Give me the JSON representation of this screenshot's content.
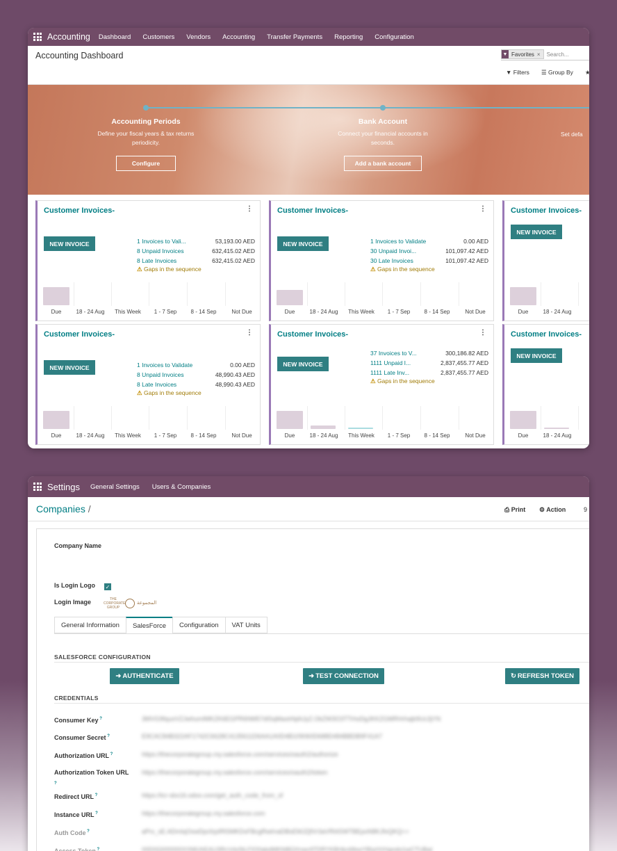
{
  "accounting": {
    "app_name": "Accounting",
    "menu": [
      "Dashboard",
      "Customers",
      "Vendors",
      "Accounting",
      "Transfer Payments",
      "Reporting",
      "Configuration"
    ],
    "page_title": "Accounting Dashboard",
    "search": {
      "facet": "Favorites",
      "placeholder": "Search..."
    },
    "filters_label": "Filters",
    "groupby_label": "Group By",
    "onboarding": {
      "steps": [
        {
          "title": "Accounting Periods",
          "desc": "Define your fiscal years & tax returns periodicity.",
          "button": "Configure"
        },
        {
          "title": "Bank Account",
          "desc": "Connect your financial accounts in seconds.",
          "button": "Add a bank account"
        },
        {
          "title": "",
          "desc": "Set defa",
          "button": ""
        }
      ]
    },
    "cards": [
      {
        "title": "Customer Invoices-",
        "button": "NEW INVOICE",
        "stats": [
          {
            "label": "1 Invoices to Vali...",
            "value": "53,193.00 AED"
          },
          {
            "label": "8 Unpaid Invoices",
            "value": "632,415.02 AED"
          },
          {
            "label": "8 Late Invoices",
            "value": "632,415.02 AED"
          }
        ],
        "warning": "Gaps in the sequence",
        "chart": {
          "type": "bar",
          "categories": [
            "Due",
            "18 - 24 Aug",
            "This Week",
            "1 - 7 Sep",
            "8 - 14 Sep",
            "Not Due"
          ],
          "values": [
            1,
            0,
            0,
            0,
            0,
            0
          ]
        }
      },
      {
        "title": "Customer Invoices-",
        "button": "NEW INVOICE",
        "stats": [
          {
            "label": "1 Invoices to Validate",
            "value": "0.00 AED"
          },
          {
            "label": "30 Unpaid Invoi...",
            "value": "101,097.42 AED"
          },
          {
            "label": "30 Late Invoices",
            "value": "101,097.42 AED"
          }
        ],
        "warning": "Gaps in the sequence",
        "chart": {
          "type": "bar",
          "categories": [
            "Due",
            "18 - 24 Aug",
            "This Week",
            "1 - 7 Sep",
            "8 - 14 Sep",
            "Not Due"
          ],
          "values": [
            0.85,
            0,
            0,
            0,
            0,
            0
          ]
        }
      },
      {
        "title": "Customer Invoices-",
        "button": "NEW INVOICE",
        "stats": [],
        "warning": "",
        "chart": {
          "type": "bar",
          "categories": [
            "Due",
            "18 - 24 Aug",
            "Th"
          ],
          "values": [
            1,
            0,
            0
          ]
        }
      },
      {
        "title": "Customer Invoices-",
        "button": "NEW INVOICE",
        "stats": [
          {
            "label": "1 Invoices to Validate",
            "value": "0.00 AED"
          },
          {
            "label": "8 Unpaid Invoices",
            "value": "48,990.43 AED"
          },
          {
            "label": "8 Late Invoices",
            "value": "48,990.43 AED"
          }
        ],
        "warning": "Gaps in the sequence",
        "chart": {
          "type": "bar",
          "categories": [
            "Due",
            "18 - 24 Aug",
            "This Week",
            "1 - 7 Sep",
            "8 - 14 Sep",
            "Not Due"
          ],
          "values": [
            1,
            0,
            0,
            0,
            0,
            0
          ]
        }
      },
      {
        "title": "Customer Invoices-",
        "button": "NEW INVOICE",
        "stats": [
          {
            "label": "37 Invoices to V...",
            "value": "300,186.82 AED"
          },
          {
            "label": "1111 Unpaid I...",
            "value": "2,837,455.77 AED"
          },
          {
            "label": "1111 Late Inv...",
            "value": "2,837,455.77 AED"
          }
        ],
        "warning": "Gaps in the sequence",
        "chart": {
          "type": "bar",
          "categories": [
            "Due",
            "18 - 24 Aug",
            "This Week",
            "1 - 7 Sep",
            "8 - 14 Sep",
            "Not Due"
          ],
          "values": [
            1,
            0.18,
            0.05,
            0,
            0,
            0
          ]
        }
      },
      {
        "title": "Customer Invoices-",
        "button": "NEW INVOICE",
        "stats": [],
        "warning": "",
        "chart": {
          "type": "bar",
          "categories": [
            "Due",
            "18 - 24 Aug",
            "Th"
          ],
          "values": [
            1,
            0.03,
            0
          ]
        }
      }
    ]
  },
  "settings": {
    "app_name": "Settings",
    "menu": [
      "General Settings",
      "Users & Companies"
    ],
    "breadcrumb": "Companies",
    "breadcrumb_sep": "/",
    "print_label": "Print",
    "action_label": "Action",
    "pager": "9",
    "company_name_label": "Company Name",
    "is_login_logo_label": "Is Login Logo",
    "is_login_logo_checked": true,
    "login_image_label": "Login Image",
    "logo_text": {
      "left": "THE CORPORATE GROUP",
      "right": "المجموعة"
    },
    "tabs": [
      "General Information",
      "SalesForce",
      "Configuration",
      "VAT Units"
    ],
    "active_tab": "SalesForce",
    "sf_section": "SALESFORCE CONFIGURATION",
    "buttons": {
      "authenticate": "AUTHENTICATE",
      "test": "TEST CONNECTION",
      "refresh": "REFRESH TOKEN"
    },
    "cred_section": "CREDENTIALS",
    "fields": [
      {
        "label": "Consumer Key",
        "value": "3MVG9fquoVZJwhumIMKZK6EGPR6NM57dlSqMaxtrfqlAJyZ.OkZW3O3TTrhsDgJKKZGMRHrhajb9Uc3jYN"
      },
      {
        "label": "Consumer Secret",
        "value": "E9CAC84B322AF1742C6628C4135611D6AA1A0D4B109060D688D484BBDB9F41A7"
      },
      {
        "label": "Authorization URL",
        "value": "https://thecorporategroup.my.salesforce.com/services/oauth2/authorize"
      },
      {
        "label": "Authorization Token URL",
        "value": "https://thecorporategroup.my.salesforce.com/services/oauth2/token"
      },
      {
        "label": "Redirect URL",
        "value": "https://tcr-sbx16.odoo.com/get_auth_code_from_sf"
      },
      {
        "label": "Instance URL",
        "value": "https://thecorporategroup.my.salesforce.com"
      },
      {
        "label": "Auth Code",
        "value": "aPrx_sE.ADmIqOswDpcfzpIRlSMKDxFBcgRwt/vaDBsEMJZjfVr3aVRl4SWTBEpoN8KJfxQKQ=="
      },
      {
        "label": "Access Token",
        "value": "00D0Q000000XXMUhEAU3RcVdv5tLFIO0abdMKfd8QXnwrATDRYKBHkn6lbwYBIyHVHgndo1wCTUBaI"
      }
    ]
  }
}
